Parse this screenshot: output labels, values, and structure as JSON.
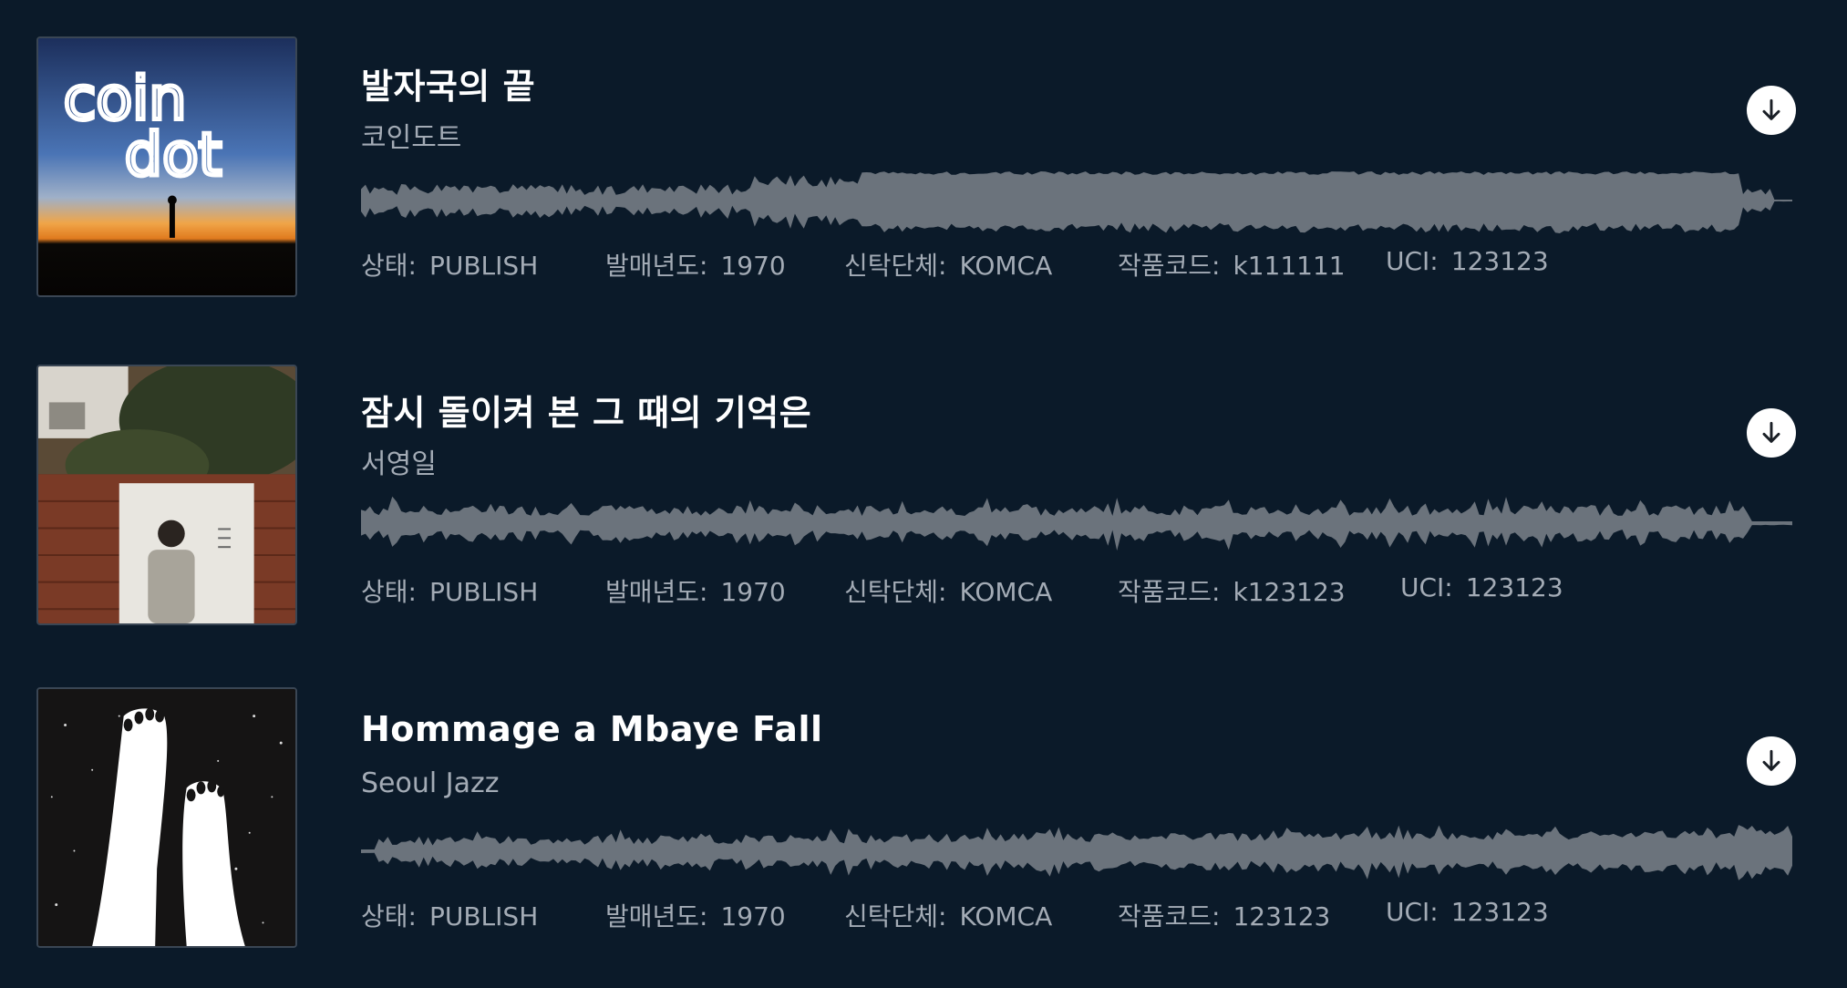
{
  "tracks": [
    {
      "title": "발자국의 끝",
      "artist": "코인도트",
      "cover_text_line1": "coin",
      "cover_text_line2": "dot",
      "meta": {
        "status_label": "상태:",
        "status_value": "PUBLISH",
        "year_label": "발매년도:",
        "year_value": "1970",
        "trust_label": "신탁단체:",
        "trust_value": "KOMCA",
        "code_label": "작품코드:",
        "code_value": "k111111",
        "uci_label": "UCI:",
        "uci_value": "123123"
      },
      "download_icon": "download-icon"
    },
    {
      "title": "잠시 돌이켜 본 그 때의 기억은",
      "artist": "서영일",
      "meta": {
        "status_label": "상태:",
        "status_value": "PUBLISH",
        "year_label": "발매년도:",
        "year_value": "1970",
        "trust_label": "신탁단체:",
        "trust_value": "KOMCA",
        "code_label": "작품코드:",
        "code_value": "k123123",
        "uci_label": "UCI:",
        "uci_value": "123123"
      },
      "download_icon": "download-icon"
    },
    {
      "title": "Hommage a Mbaye Fall",
      "artist": "Seoul Jazz",
      "meta": {
        "status_label": "상태:",
        "status_value": "PUBLISH",
        "year_label": "발매년도:",
        "year_value": "1970",
        "trust_label": "신탁단체:",
        "trust_value": "KOMCA",
        "code_label": "작품코드:",
        "code_value": "123123",
        "uci_label": "UCI:",
        "uci_value": "123123"
      },
      "download_icon": "download-icon"
    }
  ],
  "colors": {
    "background": "#0b1a29",
    "waveform": "#6b737c",
    "muted_text": "#a3abb5",
    "title_text": "#ffffff"
  }
}
